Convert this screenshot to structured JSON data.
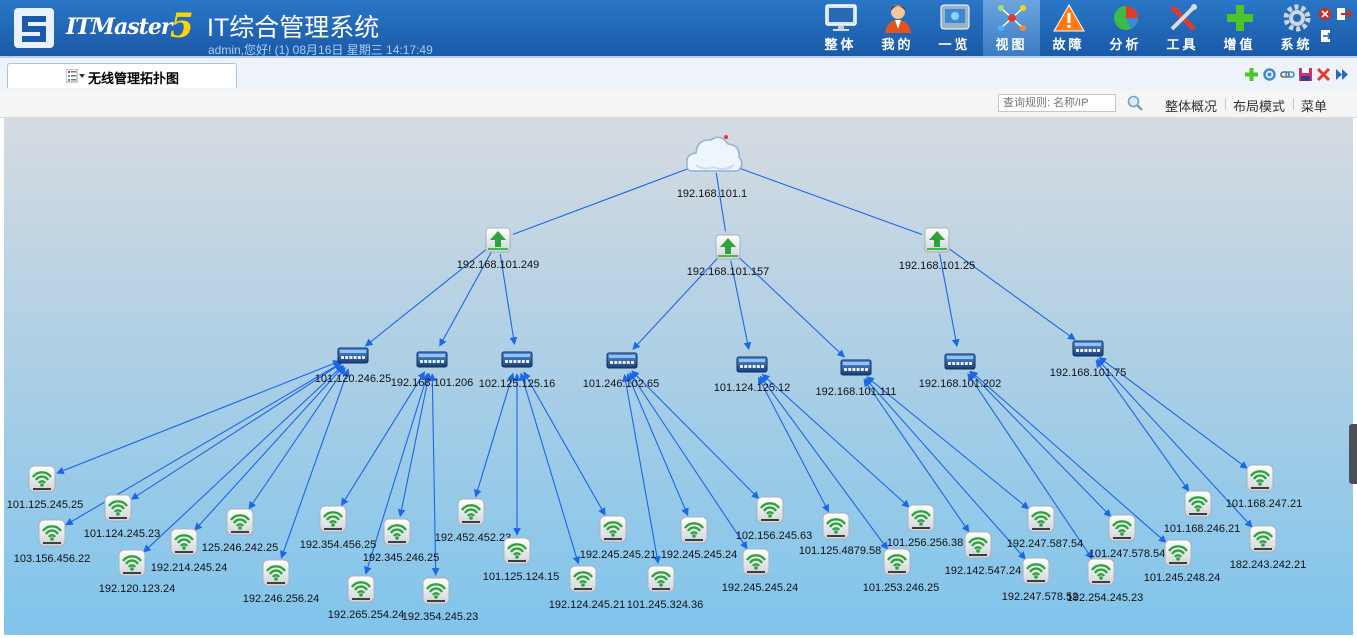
{
  "header": {
    "brand": "ITMaster",
    "brand_version": "5",
    "title": "IT综合管理系统",
    "user_line": "admin,您好! (1) 08月16日 星期三 14:17:49",
    "nav": [
      {
        "id": "overall",
        "label": "整体",
        "icon": "monitor-icon"
      },
      {
        "id": "mine",
        "label": "我的",
        "icon": "user-icon"
      },
      {
        "id": "overview",
        "label": "一览",
        "icon": "screen-list-icon"
      },
      {
        "id": "view",
        "label": "视图",
        "icon": "topology-icon",
        "active": true
      },
      {
        "id": "fault",
        "label": "故障",
        "icon": "warning-icon"
      },
      {
        "id": "analysis",
        "label": "分析",
        "icon": "pie-chart-icon"
      },
      {
        "id": "tools",
        "label": "工具",
        "icon": "tools-icon"
      },
      {
        "id": "addon",
        "label": "增值",
        "icon": "plus-icon"
      },
      {
        "id": "system",
        "label": "系统",
        "icon": "gear-icon"
      }
    ]
  },
  "tab": {
    "label": "无线管理拓扑图"
  },
  "toolbar": {
    "search_placeholder": "查询规则: 名称/IP",
    "links": [
      "整体概况",
      "布局模式",
      "菜单"
    ]
  },
  "colors": {
    "header": "#1f65b4",
    "link": "#1c66e8",
    "accent": "#ffd400"
  },
  "topology": {
    "root": {
      "id": "root",
      "ip": "192.168.101.1",
      "type": "cloud"
    },
    "routers": [
      {
        "id": "r1",
        "ip": "192.168.101.249",
        "parent": "root"
      },
      {
        "id": "r2",
        "ip": "192.168.101.157",
        "parent": "root"
      },
      {
        "id": "r3",
        "ip": "192.168.101.25",
        "parent": "root"
      }
    ],
    "switches": [
      {
        "id": "s1",
        "ip": "101.120.246.25",
        "parent": "r1"
      },
      {
        "id": "s2",
        "ip": "192.168.101.206",
        "parent": "r1"
      },
      {
        "id": "s3",
        "ip": "102.125.125.16",
        "parent": "r1"
      },
      {
        "id": "s4",
        "ip": "101.246.102.65",
        "parent": "r2"
      },
      {
        "id": "s5",
        "ip": "101.124.125.12",
        "parent": "r2"
      },
      {
        "id": "s6",
        "ip": "192.168.101.111",
        "parent": "r2"
      },
      {
        "id": "s7",
        "ip": "192.168.101.202",
        "parent": "r3"
      },
      {
        "id": "s8",
        "ip": "192.168.101.75",
        "parent": "r3"
      }
    ],
    "aps": [
      {
        "ip": "101.125.245.25",
        "parent": "s1"
      },
      {
        "ip": "101.124.245.23",
        "parent": "s1"
      },
      {
        "ip": "103.156.456.22",
        "parent": "s1"
      },
      {
        "ip": "125.246.242.25",
        "parent": "s1"
      },
      {
        "ip": "192.214.245.24",
        "parent": "s1"
      },
      {
        "ip": "192.120.123.24",
        "parent": "s1"
      },
      {
        "ip": "192.246.256.24",
        "parent": "s1"
      },
      {
        "ip": "192.354.456.25",
        "parent": "s2"
      },
      {
        "ip": "192.345.246.25",
        "parent": "s2"
      },
      {
        "ip": "192.265.254.24",
        "parent": "s2"
      },
      {
        "ip": "192.354.245.23",
        "parent": "s2"
      },
      {
        "ip": "192.452.452.23",
        "parent": "s3"
      },
      {
        "ip": "101.125.124.15",
        "parent": "s3"
      },
      {
        "ip": "192.124.245.21",
        "parent": "s3"
      },
      {
        "ip": "192.245.245.21",
        "parent": "s3"
      },
      {
        "ip": "101.245.324.36",
        "parent": "s4"
      },
      {
        "ip": "192.245.245.24",
        "parent": "s4"
      },
      {
        "ip": "192.245.245.24",
        "parent": "s4"
      },
      {
        "ip": "102.156.245.63",
        "parent": "s4"
      },
      {
        "ip": "101.125.4879.58",
        "parent": "s5"
      },
      {
        "ip": "101.256.256.38",
        "parent": "s5"
      },
      {
        "ip": "101.253.246.25",
        "parent": "s5"
      },
      {
        "ip": "192.142.547.24",
        "parent": "s6"
      },
      {
        "ip": "192.247.587.54",
        "parent": "s6"
      },
      {
        "ip": "192.247.578.52",
        "parent": "s6"
      },
      {
        "ip": "101.247.578.54",
        "parent": "s7"
      },
      {
        "ip": "101.245.248.24",
        "parent": "s7"
      },
      {
        "ip": "192.254.245.23",
        "parent": "s7"
      },
      {
        "ip": "101.168.246.21",
        "parent": "s8"
      },
      {
        "ip": "101.168.247.21",
        "parent": "s8"
      },
      {
        "ip": "182.243.242.21",
        "parent": "s8"
      }
    ]
  }
}
